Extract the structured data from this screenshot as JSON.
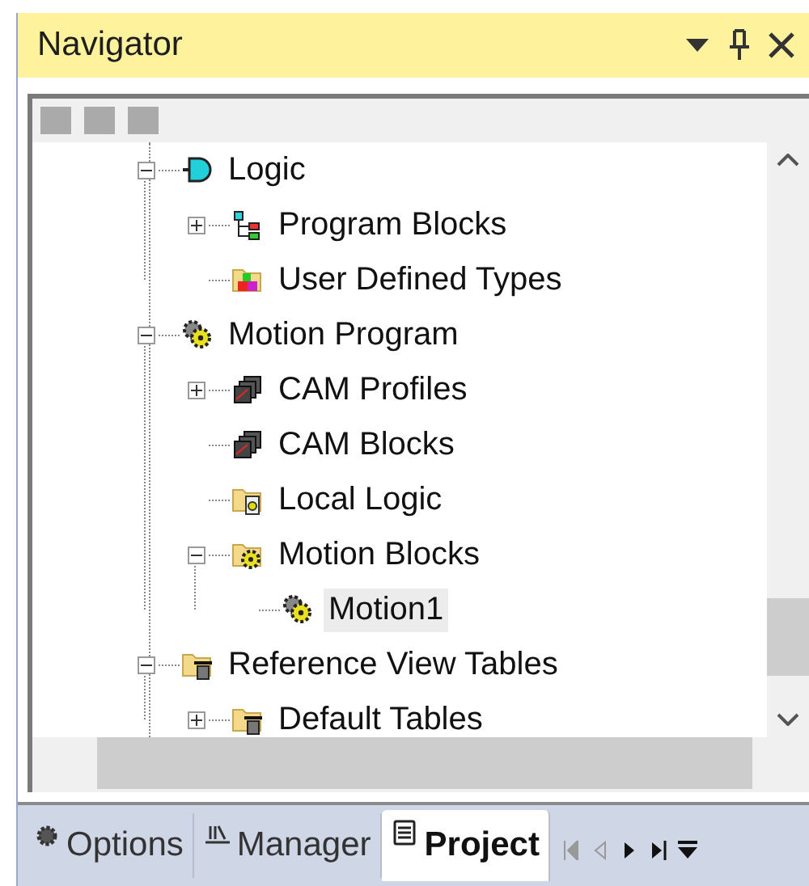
{
  "panel": {
    "title": "Navigator"
  },
  "tree": [
    {
      "label": "Logic",
      "kind": "logic",
      "selected": false,
      "expanded": true,
      "children": [
        {
          "label": "Program Blocks",
          "kind": "hierarchy",
          "selected": false,
          "expanded": false
        },
        {
          "label": "User Defined Types",
          "kind": "types",
          "selected": false
        }
      ]
    },
    {
      "label": "Motion Program",
      "kind": "gears",
      "selected": false,
      "expanded": true,
      "children": [
        {
          "label": "CAM Profiles",
          "kind": "cam",
          "selected": false,
          "expanded": false
        },
        {
          "label": "CAM Blocks",
          "kind": "cam",
          "selected": false
        },
        {
          "label": "Local Logic",
          "kind": "folder-logic",
          "selected": false
        },
        {
          "label": "Motion Blocks",
          "kind": "folder-gear",
          "selected": false,
          "expanded": true,
          "children": [
            {
              "label": "Motion1",
              "kind": "gears",
              "selected": true
            }
          ]
        }
      ]
    },
    {
      "label": "Reference View Tables",
      "kind": "folder-table",
      "selected": false,
      "expanded": true,
      "children": [
        {
          "label": "Default Tables",
          "kind": "folder-table",
          "selected": false,
          "expanded": false
        }
      ]
    }
  ],
  "tabs": [
    {
      "label": "Options",
      "kind": "gear",
      "selected": false
    },
    {
      "label": "Manager",
      "kind": "manager",
      "selected": false
    },
    {
      "label": "Project",
      "kind": "project",
      "selected": true
    }
  ]
}
